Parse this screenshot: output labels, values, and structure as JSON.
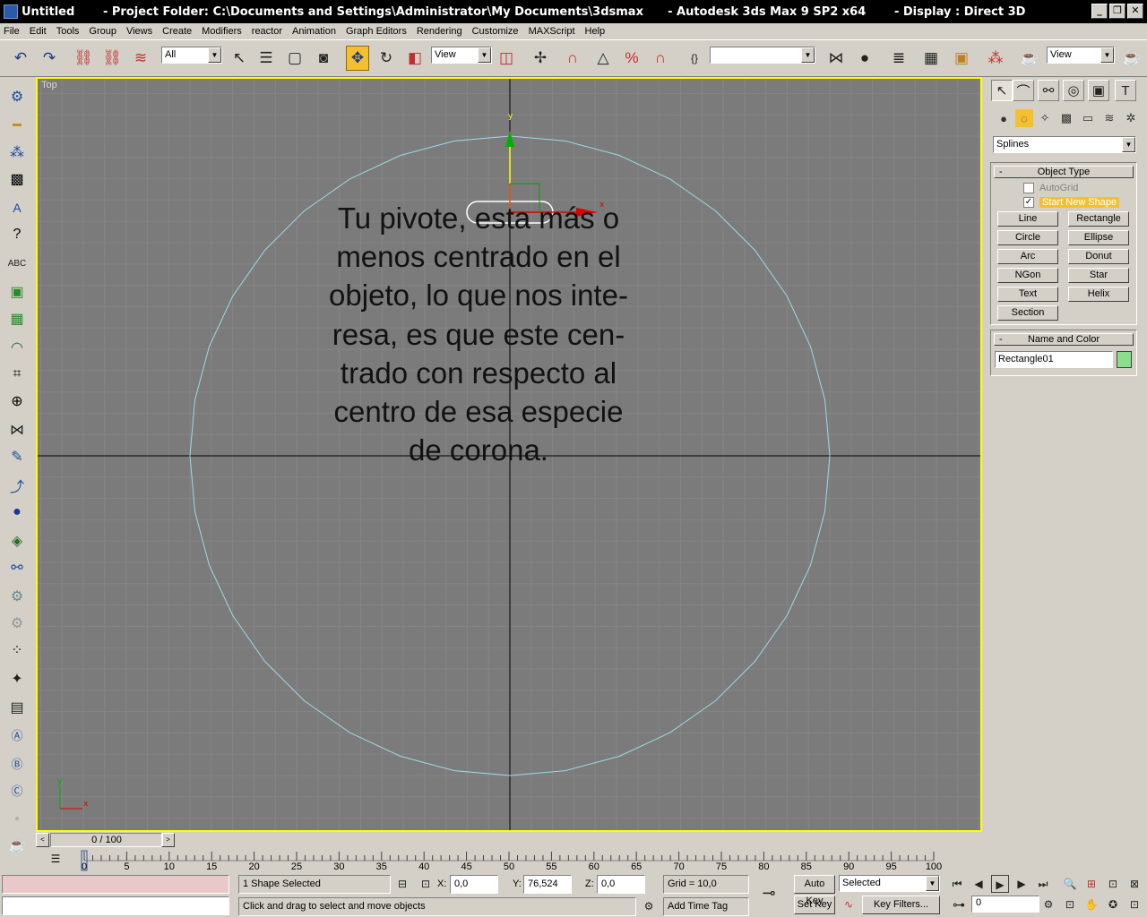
{
  "window": {
    "title": "Untitled       - Project Folder: C:\\Documents and Settings\\Administrator\\My Documents\\3dsmax      - Autodesk 3ds Max 9 SP2 x64       - Display : Direct 3D",
    "minimize": "_",
    "maximize": "❐",
    "close": "✕"
  },
  "menu": [
    "File",
    "Edit",
    "Tools",
    "Group",
    "Views",
    "Create",
    "Modifiers",
    "reactor",
    "Animation",
    "Graph Editors",
    "Rendering",
    "Customize",
    "MAXScript",
    "Help"
  ],
  "toolbar": {
    "selection_filter": "All",
    "ref_coord": "View",
    "named_selection": "",
    "render_view": "View"
  },
  "viewport": {
    "label": "Top",
    "overlay_lines": [
      "Tu pivote, esta más o",
      "menos centrado en el",
      "objeto, lo que nos inte-",
      "resa, es que este cen-",
      "trado con respecto al",
      "centro de esa especie",
      "de corona."
    ],
    "gizmo_x": "x",
    "gizmo_y": "y",
    "axis_x": "x",
    "axis_y": "y",
    "shape_color": "#9ed8e8",
    "bg_color": "#7b7b7b",
    "border_color": "#ffff00"
  },
  "command_panel": {
    "category": "Splines",
    "object_type": {
      "header": "Object Type",
      "autogrid": "AutoGrid",
      "start_new_shape": "Start New Shape",
      "start_new_shape_checked": true,
      "buttons": [
        "Line",
        "Rectangle",
        "Circle",
        "Ellipse",
        "Arc",
        "Donut",
        "NGon",
        "Star",
        "Text",
        "Helix",
        "Section"
      ]
    },
    "name_and_color": {
      "header": "Name and Color",
      "name": "Rectangle01",
      "color": "#8ae08a"
    }
  },
  "time_slider": {
    "position": "0 / 100",
    "left": "<",
    "right": ">"
  },
  "trackbar": {
    "ticks": [
      "0",
      "5",
      "10",
      "15",
      "20",
      "25",
      "30",
      "35",
      "40",
      "45",
      "50",
      "55",
      "60",
      "65",
      "70",
      "75",
      "80",
      "85",
      "90",
      "95",
      "100"
    ]
  },
  "status": {
    "selection": "1 Shape Selected",
    "prompt": "Click and drag to select and move objects",
    "x_label": "X:",
    "x": "0,0",
    "y_label": "Y:",
    "y": "76,524",
    "z_label": "Z:",
    "z": "0,0",
    "grid": "Grid = 10,0",
    "add_time_tag": "Add Time Tag",
    "auto_key": "Auto Key",
    "set_key": "Set Key",
    "key_mode": "Selected",
    "key_filters": "Key Filters...",
    "frame": "0"
  },
  "icons": {
    "undo": "↶",
    "redo": "↷",
    "select": "↖",
    "move": "✥",
    "rotate": "↻",
    "key": "⊸",
    "lock": "🔒",
    "play": "▶",
    "prev": "◀",
    "next": "▶",
    "first": "⏮",
    "last": "⏭",
    "zoom": "🔍",
    "pan": "✋"
  }
}
